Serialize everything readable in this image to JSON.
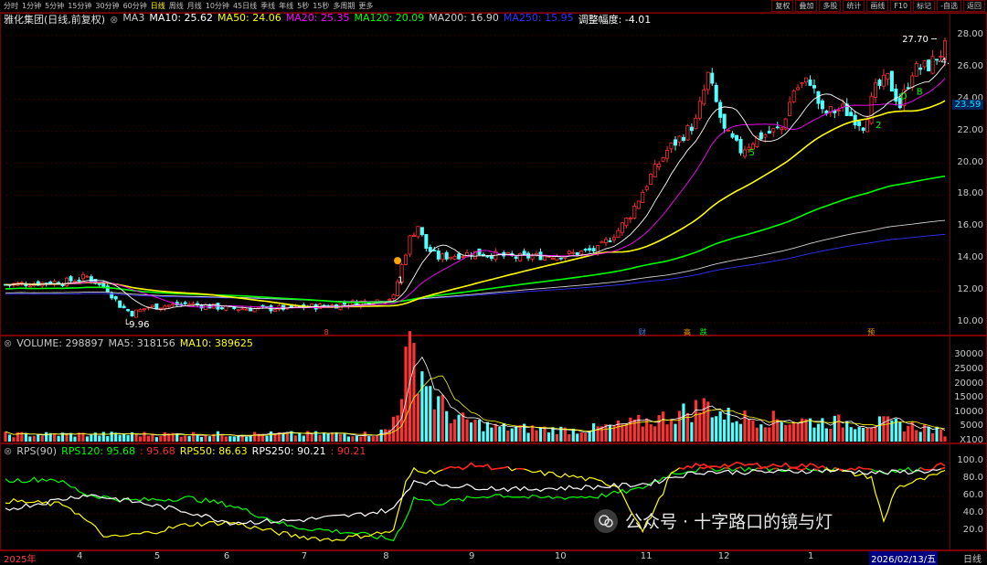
{
  "timeframes": [
    {
      "label": "分时"
    },
    {
      "label": "1分钟"
    },
    {
      "label": "5分钟"
    },
    {
      "label": "15分钟"
    },
    {
      "label": "30分钟"
    },
    {
      "label": "60分钟"
    },
    {
      "label": "日线",
      "active": true
    },
    {
      "label": "周线"
    },
    {
      "label": "月线"
    },
    {
      "label": "10分钟"
    },
    {
      "label": "45日线"
    },
    {
      "label": "季线"
    },
    {
      "label": "年线"
    },
    {
      "label": "5秒"
    },
    {
      "label": "15秒"
    },
    {
      "label": "多周期"
    },
    {
      "label": "更多"
    }
  ],
  "toolbar": [
    "复权",
    "叠加",
    "多股",
    "统计",
    "画线",
    "F10",
    "标记",
    "-自选",
    "返回"
  ],
  "price_legend": {
    "title": "雅化集团(日线,前复权)",
    "items": [
      {
        "text": "MA3",
        "color": "#c8c8c8"
      },
      {
        "text": "MA10: 25.62",
        "color": "#ffffff"
      },
      {
        "text": "MA50: 24.06",
        "color": "#ffff00"
      },
      {
        "text": "MA20: 25.35",
        "color": "#ff00ff"
      },
      {
        "text": "MA120: 20.09",
        "color": "#00ff00"
      },
      {
        "text": "MA200: 16.90",
        "color": "#d0d0d0"
      },
      {
        "text": "MA250: 15.95",
        "color": "#3030ff"
      },
      {
        "text": "调整幅度: -4.01",
        "color": "#ffffff"
      }
    ]
  },
  "volume_legend": {
    "items": [
      {
        "text": "VOLUME: 298897",
        "color": "#c8c8c8"
      },
      {
        "text": "MA5: 318156",
        "color": "#c8c8c8"
      },
      {
        "text": "MA10: 389625",
        "color": "#ffff00"
      }
    ]
  },
  "rps_legend": {
    "items": [
      {
        "text": "RPS(90)",
        "color": "#c8c8c8"
      },
      {
        "text": "RPS120: 95.68",
        "color": "#00ff00"
      },
      {
        "text": ": 95.68",
        "color": "#ff3030"
      },
      {
        "text": "RPS50: 86.63",
        "color": "#ffff00"
      },
      {
        "text": "RPS250: 90.21",
        "color": "#ffffff"
      },
      {
        "text": ": 90.21",
        "color": "#ff3030"
      }
    ]
  },
  "price_axis_ticks": [
    "28.00",
    "26.00",
    "24.00",
    "22.00",
    "20.00",
    "18.00",
    "16.00",
    "14.00",
    "12.00",
    "10.00"
  ],
  "current_price": "23.59",
  "volume_axis_ticks": [
    "30000",
    "25000",
    "20000",
    "15000",
    "10000",
    "5000",
    "X100"
  ],
  "rps_axis_ticks": [
    "100.0",
    "80.0",
    "60.0",
    "40.0",
    "20.0"
  ],
  "x_labels": [
    {
      "text": "2025年",
      "color": "#ff4040"
    },
    {
      "text": "4"
    },
    {
      "text": "5"
    },
    {
      "text": "6"
    },
    {
      "text": "7"
    },
    {
      "text": "8"
    },
    {
      "text": "9"
    },
    {
      "text": "10"
    },
    {
      "text": "11"
    },
    {
      "text": "12"
    },
    {
      "text": "1"
    },
    {
      "text": "2026/02/13/五",
      "highlight": true
    }
  ],
  "period_label": "日线",
  "annotations": {
    "low": "9.96",
    "high": "27.70",
    "high_change": "-4.0",
    "wave_labels": [
      "1",
      "5",
      "2",
      "D",
      "B"
    ]
  },
  "event_markers": [
    "8",
    "财",
    "高",
    "跌",
    "预"
  ],
  "watermark": {
    "text": "公众号 · 十字路口的镜与灯"
  },
  "chart_data": [
    {
      "type": "candlestick",
      "title": "雅化集团(日线,前复权)",
      "ylim": [
        9.5,
        28.5
      ],
      "x_months": [
        "2025年",
        "4",
        "5",
        "6",
        "7",
        "8",
        "9",
        "10",
        "11",
        "12",
        "1",
        "2026/02/13/五"
      ],
      "waypoints": [
        [
          0,
          12.4
        ],
        [
          15,
          12.6
        ],
        [
          20,
          12.9
        ],
        [
          25,
          12.1
        ],
        [
          28,
          11.1
        ],
        [
          31,
          10.6
        ],
        [
          35,
          11.0
        ],
        [
          45,
          11.2
        ],
        [
          55,
          10.9
        ],
        [
          65,
          10.9
        ],
        [
          80,
          11.1
        ],
        [
          90,
          11.4
        ],
        [
          95,
          11.6
        ],
        [
          97,
          13.6
        ],
        [
          99,
          15.3
        ],
        [
          101,
          16.1
        ],
        [
          103,
          14.7
        ],
        [
          106,
          14.1
        ],
        [
          115,
          14.4
        ],
        [
          125,
          14.1
        ],
        [
          138,
          14.3
        ],
        [
          145,
          14.6
        ],
        [
          150,
          15.8
        ],
        [
          153,
          16.8
        ],
        [
          158,
          19.2
        ],
        [
          162,
          20.8
        ],
        [
          166,
          21.8
        ],
        [
          169,
          22.6
        ],
        [
          172,
          25.5
        ],
        [
          176,
          22.0
        ],
        [
          180,
          20.8
        ],
        [
          184,
          21.6
        ],
        [
          190,
          22.2
        ],
        [
          193,
          24.6
        ],
        [
          197,
          25.2
        ],
        [
          200,
          23.1
        ],
        [
          205,
          23.4
        ],
        [
          210,
          22.4
        ],
        [
          213,
          24.6
        ],
        [
          216,
          25.3
        ],
        [
          219,
          23.6
        ],
        [
          222,
          25.8
        ],
        [
          226,
          26.1
        ],
        [
          230,
          27.2
        ]
      ],
      "ma_last": {
        "MA10": 25.62,
        "MA20": 25.35,
        "MA50": 24.06,
        "MA120": 20.09,
        "MA200": 16.9,
        "MA250": 15.95
      },
      "low": 9.96,
      "high": 27.7,
      "last_close": 23.59
    },
    {
      "type": "bar",
      "title": "VOLUME",
      "unit": "X100",
      "ylim": [
        0,
        32000
      ],
      "waypoints": [
        [
          0,
          2500
        ],
        [
          90,
          2700
        ],
        [
          94,
          4200
        ],
        [
          96,
          13000
        ],
        [
          98,
          27000
        ],
        [
          100,
          30500
        ],
        [
          102,
          25000
        ],
        [
          105,
          15000
        ],
        [
          110,
          8000
        ],
        [
          120,
          5000
        ],
        [
          140,
          4000
        ],
        [
          150,
          5500
        ],
        [
          160,
          8000
        ],
        [
          168,
          11000
        ],
        [
          172,
          13000
        ],
        [
          176,
          9000
        ],
        [
          185,
          8000
        ],
        [
          200,
          7000
        ],
        [
          215,
          6500
        ],
        [
          225,
          5000
        ],
        [
          230,
          3000
        ]
      ],
      "last": {
        "VOLUME": 298897,
        "MA5": 318156,
        "MA10": 389625
      }
    },
    {
      "type": "line",
      "title": "RPS(90)",
      "ylim": [
        0,
        105
      ],
      "series": [
        {
          "name": "RPS120",
          "color": "#00ff00",
          "points": [
            [
              0,
              78
            ],
            [
              12,
              80
            ],
            [
              20,
              62
            ],
            [
              30,
              55
            ],
            [
              45,
              58
            ],
            [
              55,
              50
            ],
            [
              70,
              25
            ],
            [
              85,
              18
            ],
            [
              95,
              10
            ],
            [
              98,
              35
            ],
            [
              100,
              58
            ],
            [
              106,
              52
            ],
            [
              120,
              62
            ],
            [
              130,
              58
            ],
            [
              145,
              60
            ],
            [
              155,
              68
            ],
            [
              163,
              86
            ],
            [
              168,
              90
            ],
            [
              175,
              92
            ],
            [
              190,
              91
            ],
            [
              200,
              90
            ],
            [
              210,
              93
            ],
            [
              215,
              88
            ],
            [
              220,
              90
            ],
            [
              225,
              92
            ],
            [
              230,
              96
            ]
          ]
        },
        {
          "name": "RPS50",
          "color": "#ffff00",
          "points": [
            [
              0,
              55
            ],
            [
              15,
              50
            ],
            [
              25,
              12
            ],
            [
              35,
              18
            ],
            [
              45,
              28
            ],
            [
              55,
              30
            ],
            [
              70,
              15
            ],
            [
              80,
              10
            ],
            [
              95,
              20
            ],
            [
              98,
              75
            ],
            [
              100,
              92
            ],
            [
              104,
              88
            ],
            [
              115,
              96
            ],
            [
              125,
              90
            ],
            [
              140,
              82
            ],
            [
              150,
              72
            ],
            [
              156,
              20
            ],
            [
              160,
              55
            ],
            [
              163,
              86
            ],
            [
              168,
              95
            ],
            [
              180,
              96
            ],
            [
              200,
              95
            ],
            [
              205,
              88
            ],
            [
              212,
              82
            ],
            [
              215,
              30
            ],
            [
              218,
              70
            ],
            [
              225,
              80
            ],
            [
              230,
              87
            ]
          ]
        },
        {
          "name": "RPS250",
          "color": "#ffffff",
          "points": [
            [
              0,
              45
            ],
            [
              20,
              62
            ],
            [
              30,
              55
            ],
            [
              45,
              42
            ],
            [
              55,
              30
            ],
            [
              70,
              32
            ],
            [
              85,
              38
            ],
            [
              95,
              45
            ],
            [
              98,
              65
            ],
            [
              100,
              78
            ],
            [
              110,
              72
            ],
            [
              125,
              68
            ],
            [
              140,
              70
            ],
            [
              150,
              72
            ],
            [
              158,
              75
            ],
            [
              163,
              82
            ],
            [
              170,
              88
            ],
            [
              190,
              88
            ],
            [
              200,
              90
            ],
            [
              215,
              87
            ],
            [
              230,
              90
            ]
          ]
        }
      ],
      "last": {
        "RPS120": 95.68,
        "RPS50": 86.63,
        "RPS250": 90.21
      }
    }
  ]
}
